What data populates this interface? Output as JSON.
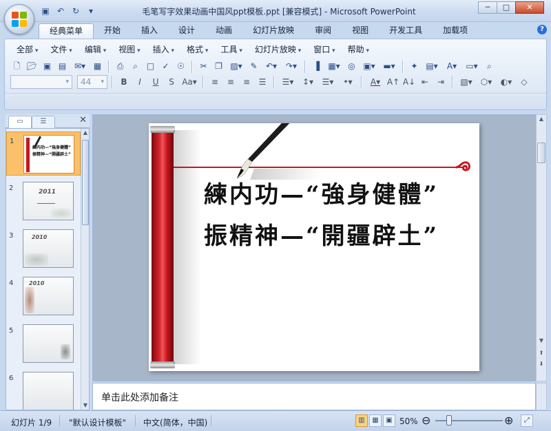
{
  "window": {
    "title": "毛笔写字效果动画中国风ppt模板.ppt [兼容模式] - Microsoft PowerPoint",
    "controls": [
      "─",
      "□",
      "✕"
    ]
  },
  "qat": {
    "icons": [
      "save-icon",
      "undo-icon",
      "redo-icon",
      "customize-qat-icon"
    ]
  },
  "ribbon": {
    "tabs": [
      "经典菜单",
      "开始",
      "插入",
      "设计",
      "动画",
      "幻灯片放映",
      "审阅",
      "视图",
      "开发工具",
      "加载项"
    ],
    "active_tab": "经典菜单",
    "menus": [
      "全部",
      "文件",
      "编辑",
      "视图",
      "插入",
      "格式",
      "工具",
      "幻灯片放映",
      "窗口",
      "帮助"
    ],
    "font_name": "",
    "font_size": "44"
  },
  "slide_pane": {
    "tab_close": "✕",
    "thumbs": [
      {
        "num": "1",
        "caption_line1": "練内功—“強身健體”",
        "caption_line2": "振精神—“開疆辟土”"
      },
      {
        "num": "2",
        "year": "2011"
      },
      {
        "num": "3",
        "year": "2010"
      },
      {
        "num": "4",
        "year": "2010"
      },
      {
        "num": "5"
      },
      {
        "num": "6"
      }
    ]
  },
  "slide": {
    "line1": "練内功—“強身健體”",
    "line2": "振精神—“開疆辟土”"
  },
  "notes": {
    "placeholder": "单击此处添加备注"
  },
  "status": {
    "slide_info": "幻灯片 1/9",
    "template": "\"默认设计模板\"",
    "language": "中文(简体，中国)",
    "zoom": "50%"
  },
  "colors": {
    "accent_red": "#c8161d",
    "ribbon_blue": "#c7d9ef",
    "selection_orange": "#fbc06a"
  }
}
